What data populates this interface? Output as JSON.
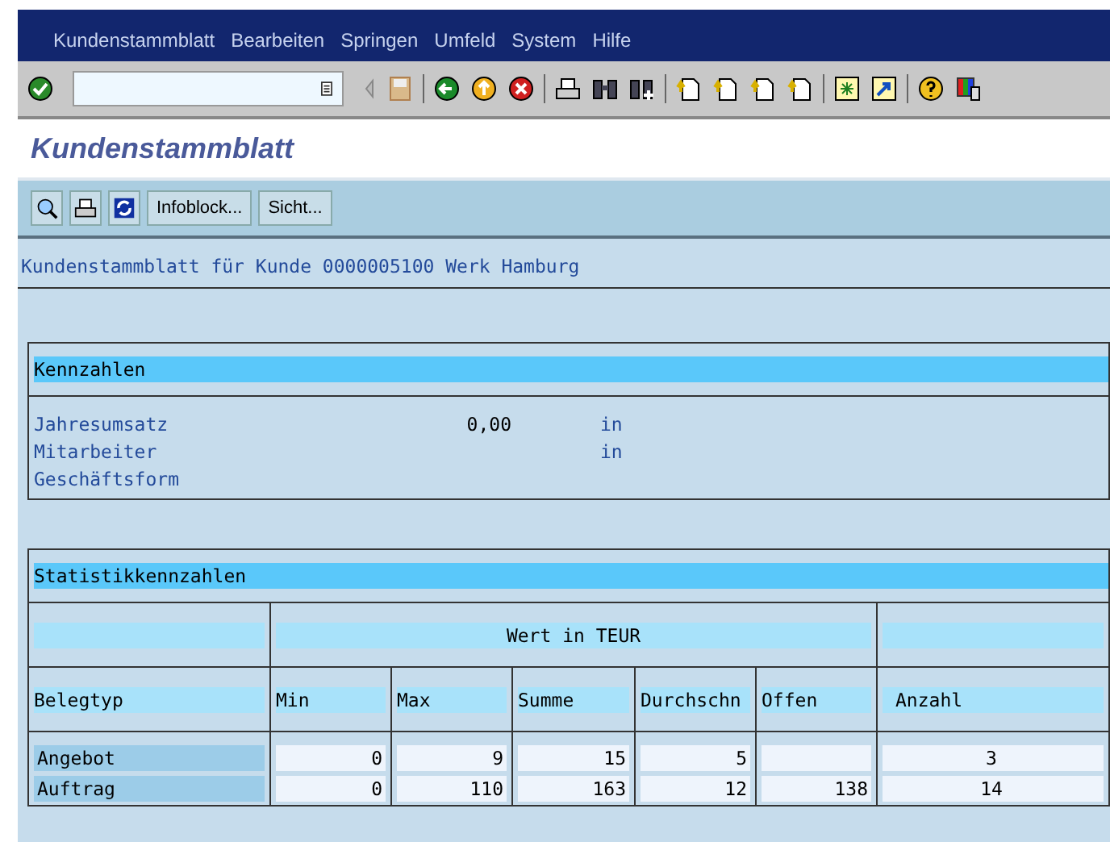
{
  "menu": [
    "Kundenstammblatt",
    "Bearbeiten",
    "Springen",
    "Umfeld",
    "System",
    "Hilfe"
  ],
  "title": "Kundenstammblatt",
  "app_toolbar": {
    "buttons": [
      "Infoblock...",
      "Sicht..."
    ]
  },
  "heading": "Kundenstammblatt für Kunde 0000005100 Werk Hamburg",
  "kennzahlen": {
    "title": "Kennzahlen",
    "rows": [
      {
        "label": "Jahresumsatz",
        "value": "0,00",
        "unit": "in"
      },
      {
        "label": "Mitarbeiter",
        "unit": "in"
      },
      {
        "label": "Geschäftsform"
      }
    ]
  },
  "statistik": {
    "title": "Statistikkennzahlen",
    "group_header": "Wert in TEUR",
    "columns": [
      "Belegtyp",
      "Min",
      "Max",
      "Summe",
      "Durchschn",
      "Offen",
      "Anzahl"
    ],
    "rows": [
      {
        "cells": [
          "Angebot",
          "0",
          "9",
          "15",
          "5",
          "",
          "3"
        ]
      },
      {
        "cells": [
          "Auftrag",
          "0",
          "110",
          "163",
          "12",
          "138",
          "14"
        ]
      }
    ]
  }
}
